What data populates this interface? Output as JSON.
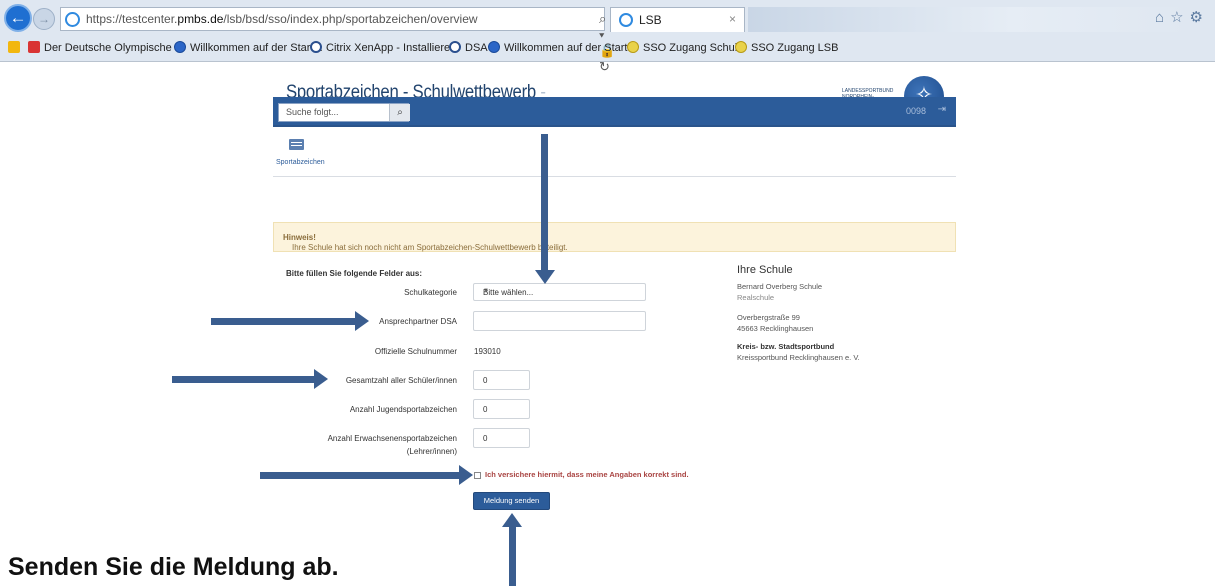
{
  "browser": {
    "url_prefix": "https://testcenter.",
    "url_domain": "pmbs.de",
    "url_path": "/lsb/bsd/sso/index.php/sportabzeichen/overview",
    "address_tools": "⌕ ▾ 🔒 ↻",
    "tab_title": "LSB",
    "tab_close": "×",
    "right_icons": "⌂☆⚙",
    "favorites": [
      "Der Deutsche Olympische ...",
      "Willkommen auf der Start...",
      "Citrix XenApp - Installiere...",
      "DSA",
      "Willkommen auf der Start...",
      "SSO Zugang Schule",
      "SSO Zugang LSB"
    ]
  },
  "site": {
    "title": "Sportabzeichen - Schulwettbewerb",
    "title_suffix": "-",
    "brand_line1": "LANDESSPORTBUND",
    "brand_line2": "NORDRHEIN-WESTFALEN",
    "search_placeholder": "Suche folgt...",
    "search_icon": "⌕",
    "user_id": "0098",
    "logout_icon": "⇥",
    "module_label": "Sportabzeichen"
  },
  "alert": {
    "strong": "Hinweis!",
    "text": " Ihre Schule hat sich noch nicht am Sportabzeichen-Schulwettbewerb beteiligt."
  },
  "form": {
    "heading": "Bitte füllen Sie folgende Felder aus:",
    "schulkategorie_label": "Schulkategorie",
    "schulkategorie_value": "Bitte wählen...",
    "ansprechpartner_label": "Ansprechpartner DSA",
    "ansprechpartner_value": "",
    "schulnummer_label": "Offizielle Schulnummer",
    "schulnummer_value": "193010",
    "gesamtzahl_label": "Gesamtzahl aller Schüler/innen",
    "gesamtzahl_value": "0",
    "jugend_label": "Anzahl Jugendsportabzeichen",
    "jugend_value": "0",
    "erwachsene_label_1": "Anzahl Erwachsenensportabzeichen",
    "erwachsene_label_2": "(Lehrer/innen)",
    "erwachsene_value": "0",
    "checkbox_label": "Ich versichere hiermit, dass meine Angaben korrekt sind.",
    "submit_label": "Meldung senden"
  },
  "school": {
    "heading": "Ihre Schule",
    "name": "Bernard Overberg Schule",
    "type": "Realschule",
    "street": "Overbergstraße 99",
    "city": "45663 Recklinghausen",
    "bund_heading": "Kreis- bzw. Stadtsportbund",
    "bund_name": "Kreissportbund Recklinghausen e. V."
  },
  "instruction": "Senden Sie die Meldung ab.",
  "colors": {
    "accent": "#2c5c9a",
    "arrow": "#3a5d8f",
    "alert_bg": "#fcf3dc",
    "warning_text": "#a94442"
  }
}
